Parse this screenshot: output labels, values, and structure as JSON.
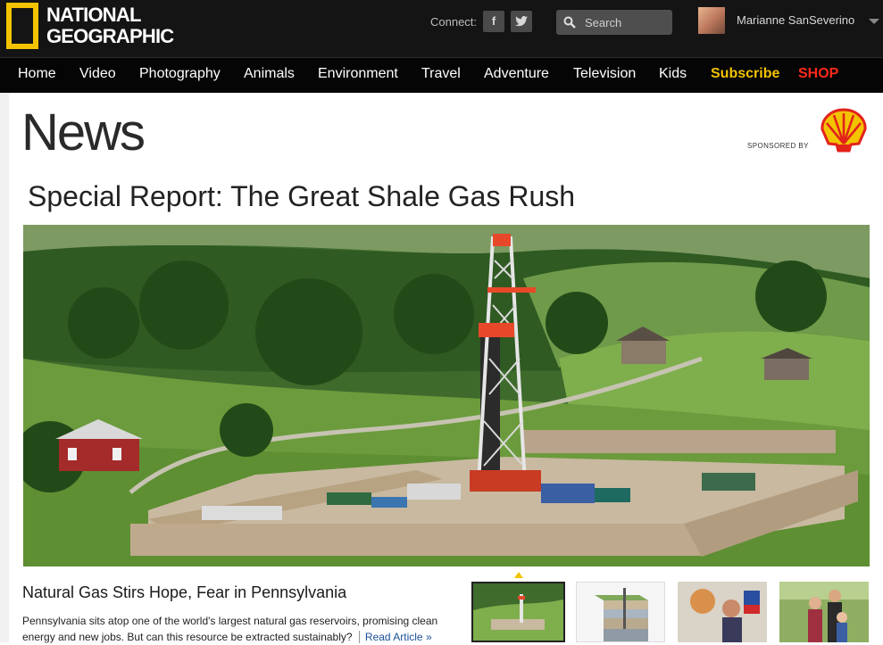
{
  "brand": {
    "line1": "NATIONAL",
    "line2": "GEOGRAPHIC",
    "frame_color": "#f3c300"
  },
  "header": {
    "connect_label": "Connect:",
    "social": [
      {
        "icon": "facebook-icon",
        "label": "f"
      },
      {
        "icon": "twitter-icon",
        "label": "t"
      }
    ],
    "search_placeholder": "Search",
    "user_name": "Marianne SanSeverino"
  },
  "nav": {
    "items": [
      "Home",
      "Video",
      "Photography",
      "Animals",
      "Environment",
      "Travel",
      "Adventure",
      "Television",
      "Kids"
    ],
    "subscribe": "Subscribe",
    "shop": "SHOP",
    "subscribe_color": "#f3c300",
    "shop_color": "#ff2a1a"
  },
  "section": {
    "title": "News",
    "sponsored_by": "SPONSORED BY",
    "sponsor_icon": "shell-logo-icon"
  },
  "report": {
    "title": "Special Report: The Great Shale Gas Rush"
  },
  "article": {
    "title": "Natural Gas Stirs Hope, Fear in Pennsylvania",
    "body": "Pennsylvania sits atop one of the world's largest natural gas reservoirs, promising clean energy and new jobs. But can this resource be extracted sustainably?",
    "read_more": "Read Article »"
  },
  "thumbnails": [
    "drilling-site-thumb",
    "rock-layers-thumb",
    "family-kitchen-thumb",
    "family-portrait-thumb"
  ]
}
